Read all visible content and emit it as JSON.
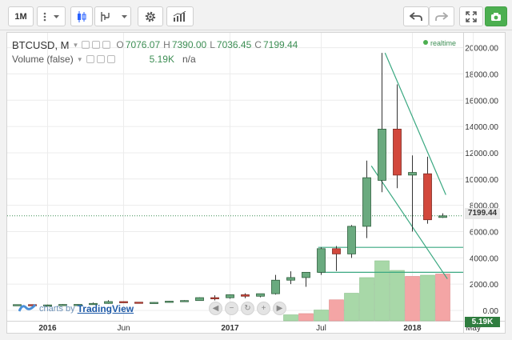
{
  "toolbar": {
    "interval": "1M",
    "icons": [
      "more-icon",
      "dropdown-icon",
      "candles-icon",
      "compare-icon",
      "dropdown-icon",
      "settings-icon",
      "indicators-icon",
      "undo-icon",
      "redo-icon",
      "fullscreen-icon",
      "snapshot-icon"
    ]
  },
  "legend": {
    "symbol": "BTCUSD, M",
    "open_label": "O",
    "open": "7076.07",
    "high_label": "H",
    "high": "7390.00",
    "low_label": "L",
    "low": "7036.45",
    "close_label": "C",
    "close": "7199.44",
    "volume_label": "Volume (false)",
    "volume_value": "5.19K",
    "volume_na": "n/a"
  },
  "realtime_label": "realtime",
  "last_price_tag": "7199.44",
  "volume_tag": "5.19K",
  "watermark": {
    "prefix": "charts by",
    "brand": "TradingView"
  },
  "colors": {
    "up": "#6aaa7f",
    "down": "#d2483c",
    "vol_up": "#a8d8a8",
    "vol_down": "#f4a5a5",
    "trend": "#3aa881",
    "accent": "#3d8e54"
  },
  "chart_data": {
    "type": "candlestick",
    "y_ticks": [
      0,
      2000,
      4000,
      6000,
      8000,
      10000,
      12000,
      14000,
      16000,
      18000,
      20000
    ],
    "y_tick_labels": [
      "0.00",
      "2000.00",
      "4000.00",
      "6000.00",
      "8000.00",
      "10000.00",
      "12000.00",
      "14000.00",
      "16000.00",
      "18000.00",
      "20000.00"
    ],
    "ylim": [
      0,
      20400
    ],
    "x_labels": [
      "2016",
      "Jun",
      "2017",
      "Jul",
      "2018",
      "May"
    ],
    "x_label_index": [
      2,
      7,
      14,
      20,
      26,
      30
    ],
    "candles": [
      {
        "o": 430,
        "h": 460,
        "l": 420,
        "c": 440
      },
      {
        "o": 440,
        "h": 450,
        "l": 370,
        "c": 370
      },
      {
        "o": 370,
        "h": 440,
        "l": 360,
        "c": 415
      },
      {
        "o": 415,
        "h": 470,
        "l": 410,
        "c": 450
      },
      {
        "o": 450,
        "h": 470,
        "l": 440,
        "c": 455
      },
      {
        "o": 455,
        "h": 600,
        "l": 450,
        "c": 530
      },
      {
        "o": 530,
        "h": 780,
        "l": 500,
        "c": 670
      },
      {
        "o": 670,
        "h": 690,
        "l": 620,
        "c": 625
      },
      {
        "o": 625,
        "h": 630,
        "l": 540,
        "c": 580
      },
      {
        "o": 580,
        "h": 630,
        "l": 570,
        "c": 610
      },
      {
        "o": 610,
        "h": 720,
        "l": 600,
        "c": 700
      },
      {
        "o": 700,
        "h": 780,
        "l": 690,
        "c": 750
      },
      {
        "o": 750,
        "h": 1000,
        "l": 740,
        "c": 970
      },
      {
        "o": 970,
        "h": 1150,
        "l": 760,
        "c": 965
      },
      {
        "o": 965,
        "h": 1220,
        "l": 890,
        "c": 1190
      },
      {
        "o": 1190,
        "h": 1300,
        "l": 930,
        "c": 1080
      },
      {
        "o": 1080,
        "h": 1280,
        "l": 1000,
        "c": 1270
      },
      {
        "o": 1270,
        "h": 2700,
        "l": 1200,
        "c": 2300
      },
      {
        "o": 2300,
        "h": 2980,
        "l": 2000,
        "c": 2500
      },
      {
        "o": 2500,
        "h": 2900,
        "l": 1800,
        "c": 2900
      },
      {
        "o": 2900,
        "h": 4800,
        "l": 2700,
        "c": 4700
      },
      {
        "o": 4700,
        "h": 4900,
        "l": 3000,
        "c": 4300
      },
      {
        "o": 4300,
        "h": 6500,
        "l": 4000,
        "c": 6400
      },
      {
        "o": 6400,
        "h": 11400,
        "l": 5500,
        "c": 10100
      },
      {
        "o": 9900,
        "h": 19600,
        "l": 9000,
        "c": 13800
      },
      {
        "o": 13800,
        "h": 17200,
        "l": 9300,
        "c": 10300
      },
      {
        "o": 10300,
        "h": 11800,
        "l": 6000,
        "c": 10500
      },
      {
        "o": 10400,
        "h": 11700,
        "l": 6600,
        "c": 6900
      },
      {
        "o": 7076.07,
        "h": 7390,
        "l": 7036.45,
        "c": 7199.44
      }
    ],
    "volume_bars": [
      {
        "i": 18,
        "v": 0.1,
        "up": true
      },
      {
        "i": 19,
        "v": 0.12,
        "up": false
      },
      {
        "i": 20,
        "v": 0.18,
        "up": true
      },
      {
        "i": 21,
        "v": 0.35,
        "up": false
      },
      {
        "i": 22,
        "v": 0.46,
        "up": true
      },
      {
        "i": 23,
        "v": 0.72,
        "up": true
      },
      {
        "i": 24,
        "v": 1.0,
        "up": true
      },
      {
        "i": 25,
        "v": 0.84,
        "up": true
      },
      {
        "i": 26,
        "v": 0.74,
        "up": false
      },
      {
        "i": 27,
        "v": 0.76,
        "up": true
      },
      {
        "i": 28,
        "v": 0.78,
        "up": false
      }
    ],
    "horizontal_lines": [
      4800,
      2900
    ],
    "trend_lines": [
      {
        "from": {
          "i": 24.2,
          "p": 19600
        },
        "to": {
          "i": 28.2,
          "p": 8800
        }
      },
      {
        "from": {
          "i": 23.3,
          "p": 11000
        },
        "to": {
          "i": 28.3,
          "p": 2400
        }
      }
    ]
  }
}
